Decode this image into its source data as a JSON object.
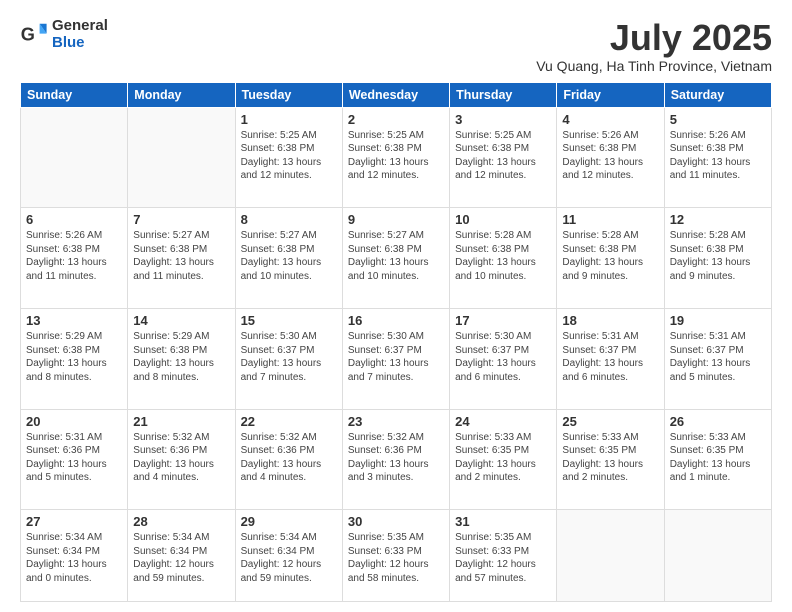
{
  "logo": {
    "general": "General",
    "blue": "Blue"
  },
  "title": "July 2025",
  "subtitle": "Vu Quang, Ha Tinh Province, Vietnam",
  "days_of_week": [
    "Sunday",
    "Monday",
    "Tuesday",
    "Wednesday",
    "Thursday",
    "Friday",
    "Saturday"
  ],
  "weeks": [
    [
      {
        "day": "",
        "info": ""
      },
      {
        "day": "",
        "info": ""
      },
      {
        "day": "1",
        "info": "Sunrise: 5:25 AM\nSunset: 6:38 PM\nDaylight: 13 hours and 12 minutes."
      },
      {
        "day": "2",
        "info": "Sunrise: 5:25 AM\nSunset: 6:38 PM\nDaylight: 13 hours and 12 minutes."
      },
      {
        "day": "3",
        "info": "Sunrise: 5:25 AM\nSunset: 6:38 PM\nDaylight: 13 hours and 12 minutes."
      },
      {
        "day": "4",
        "info": "Sunrise: 5:26 AM\nSunset: 6:38 PM\nDaylight: 13 hours and 12 minutes."
      },
      {
        "day": "5",
        "info": "Sunrise: 5:26 AM\nSunset: 6:38 PM\nDaylight: 13 hours and 11 minutes."
      }
    ],
    [
      {
        "day": "6",
        "info": "Sunrise: 5:26 AM\nSunset: 6:38 PM\nDaylight: 13 hours and 11 minutes."
      },
      {
        "day": "7",
        "info": "Sunrise: 5:27 AM\nSunset: 6:38 PM\nDaylight: 13 hours and 11 minutes."
      },
      {
        "day": "8",
        "info": "Sunrise: 5:27 AM\nSunset: 6:38 PM\nDaylight: 13 hours and 10 minutes."
      },
      {
        "day": "9",
        "info": "Sunrise: 5:27 AM\nSunset: 6:38 PM\nDaylight: 13 hours and 10 minutes."
      },
      {
        "day": "10",
        "info": "Sunrise: 5:28 AM\nSunset: 6:38 PM\nDaylight: 13 hours and 10 minutes."
      },
      {
        "day": "11",
        "info": "Sunrise: 5:28 AM\nSunset: 6:38 PM\nDaylight: 13 hours and 9 minutes."
      },
      {
        "day": "12",
        "info": "Sunrise: 5:28 AM\nSunset: 6:38 PM\nDaylight: 13 hours and 9 minutes."
      }
    ],
    [
      {
        "day": "13",
        "info": "Sunrise: 5:29 AM\nSunset: 6:38 PM\nDaylight: 13 hours and 8 minutes."
      },
      {
        "day": "14",
        "info": "Sunrise: 5:29 AM\nSunset: 6:38 PM\nDaylight: 13 hours and 8 minutes."
      },
      {
        "day": "15",
        "info": "Sunrise: 5:30 AM\nSunset: 6:37 PM\nDaylight: 13 hours and 7 minutes."
      },
      {
        "day": "16",
        "info": "Sunrise: 5:30 AM\nSunset: 6:37 PM\nDaylight: 13 hours and 7 minutes."
      },
      {
        "day": "17",
        "info": "Sunrise: 5:30 AM\nSunset: 6:37 PM\nDaylight: 13 hours and 6 minutes."
      },
      {
        "day": "18",
        "info": "Sunrise: 5:31 AM\nSunset: 6:37 PM\nDaylight: 13 hours and 6 minutes."
      },
      {
        "day": "19",
        "info": "Sunrise: 5:31 AM\nSunset: 6:37 PM\nDaylight: 13 hours and 5 minutes."
      }
    ],
    [
      {
        "day": "20",
        "info": "Sunrise: 5:31 AM\nSunset: 6:36 PM\nDaylight: 13 hours and 5 minutes."
      },
      {
        "day": "21",
        "info": "Sunrise: 5:32 AM\nSunset: 6:36 PM\nDaylight: 13 hours and 4 minutes."
      },
      {
        "day": "22",
        "info": "Sunrise: 5:32 AM\nSunset: 6:36 PM\nDaylight: 13 hours and 4 minutes."
      },
      {
        "day": "23",
        "info": "Sunrise: 5:32 AM\nSunset: 6:36 PM\nDaylight: 13 hours and 3 minutes."
      },
      {
        "day": "24",
        "info": "Sunrise: 5:33 AM\nSunset: 6:35 PM\nDaylight: 13 hours and 2 minutes."
      },
      {
        "day": "25",
        "info": "Sunrise: 5:33 AM\nSunset: 6:35 PM\nDaylight: 13 hours and 2 minutes."
      },
      {
        "day": "26",
        "info": "Sunrise: 5:33 AM\nSunset: 6:35 PM\nDaylight: 13 hours and 1 minute."
      }
    ],
    [
      {
        "day": "27",
        "info": "Sunrise: 5:34 AM\nSunset: 6:34 PM\nDaylight: 13 hours and 0 minutes."
      },
      {
        "day": "28",
        "info": "Sunrise: 5:34 AM\nSunset: 6:34 PM\nDaylight: 12 hours and 59 minutes."
      },
      {
        "day": "29",
        "info": "Sunrise: 5:34 AM\nSunset: 6:34 PM\nDaylight: 12 hours and 59 minutes."
      },
      {
        "day": "30",
        "info": "Sunrise: 5:35 AM\nSunset: 6:33 PM\nDaylight: 12 hours and 58 minutes."
      },
      {
        "day": "31",
        "info": "Sunrise: 5:35 AM\nSunset: 6:33 PM\nDaylight: 12 hours and 57 minutes."
      },
      {
        "day": "",
        "info": ""
      },
      {
        "day": "",
        "info": ""
      }
    ]
  ]
}
